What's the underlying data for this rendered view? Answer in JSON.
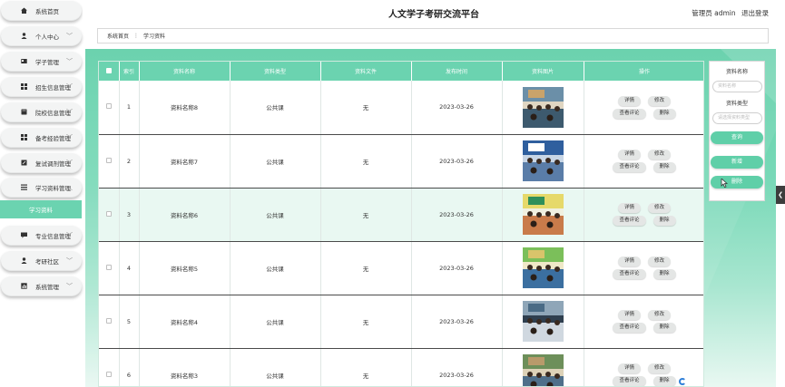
{
  "sidebar": {
    "items": [
      {
        "label": "系统首页",
        "icon": "home-icon",
        "chevron": false
      },
      {
        "label": "个人中心",
        "icon": "user-icon",
        "chevron": true
      },
      {
        "label": "学子管理",
        "icon": "id-card-icon",
        "chevron": true
      },
      {
        "label": "招生信息管理",
        "icon": "grid-icon",
        "chevron": true
      },
      {
        "label": "院校信息管理",
        "icon": "book-icon",
        "chevron": true
      },
      {
        "label": "备考经验管理",
        "icon": "grid-icon",
        "chevron": true
      },
      {
        "label": "复试调剂管理",
        "icon": "pencil-icon",
        "chevron": true
      },
      {
        "label": "学习资料管理",
        "icon": "list-icon",
        "chevron": true,
        "expanded": true
      }
    ],
    "active_sub": "学习资料",
    "items_after": [
      {
        "label": "专业信息管理",
        "icon": "message-icon",
        "chevron": true
      },
      {
        "label": "考研社区",
        "icon": "user-icon",
        "chevron": true
      },
      {
        "label": "系统管理",
        "icon": "chart-icon",
        "chevron": true
      }
    ]
  },
  "header": {
    "title": "人文学子考研交流平台",
    "role": "管理员 admin",
    "logout": "退出登录"
  },
  "breadcrumb": {
    "home": "系统首页",
    "sep": "⋮",
    "current": "学习资料"
  },
  "table": {
    "columns": [
      "",
      "索引",
      "资料名称",
      "资料类型",
      "资料文件",
      "发布时间",
      "资料图片",
      "操作"
    ],
    "rows": [
      {
        "index": "1",
        "name": "资料名称8",
        "type": "公共课",
        "file": "无",
        "date": "2023-03-26"
      },
      {
        "index": "2",
        "name": "资料名称7",
        "type": "公共课",
        "file": "无",
        "date": "2023-03-26"
      },
      {
        "index": "3",
        "name": "资料名称6",
        "type": "公共课",
        "file": "无",
        "date": "2023-03-26"
      },
      {
        "index": "4",
        "name": "资料名称5",
        "type": "公共课",
        "file": "无",
        "date": "2023-03-26"
      },
      {
        "index": "5",
        "name": "资料名称4",
        "type": "公共课",
        "file": "无",
        "date": "2023-03-26"
      },
      {
        "index": "6",
        "name": "资料名称3",
        "type": "公共课",
        "file": "无",
        "date": "2023-03-26"
      }
    ],
    "actions": {
      "detail": "详情",
      "edit": "修改",
      "comments": "查看评论",
      "delete": "删除"
    }
  },
  "search_panel": {
    "name_label": "资料名称",
    "name_placeholder": "资料名称",
    "type_label": "资料类型",
    "type_placeholder": "请选择资料类型",
    "query_button": "查询",
    "add_button": "新增",
    "delete_button": "删除"
  },
  "colors": {
    "accent": "#5fcfa8",
    "header_row": "#6bd3b0",
    "alt_row": "#e9f8f2"
  },
  "edge_handle": "❮"
}
